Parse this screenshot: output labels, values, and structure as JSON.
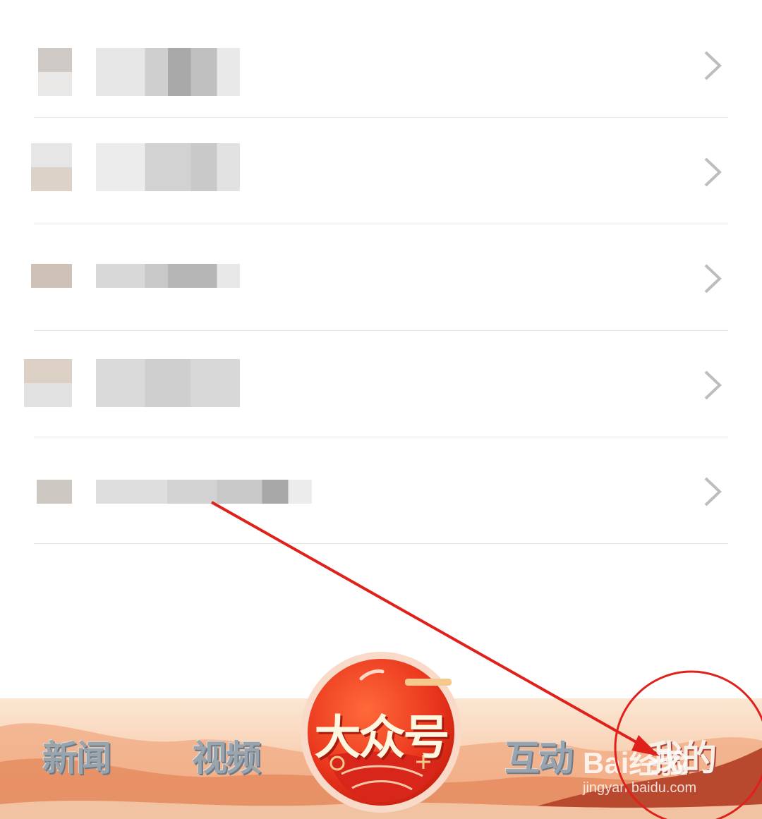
{
  "list": {
    "rows": [
      {
        "label": "",
        "state": "pixelated"
      },
      {
        "label": "",
        "state": "pixelated"
      },
      {
        "label": "",
        "state": "pixelated"
      },
      {
        "label": "",
        "state": "pixelated"
      },
      {
        "label": "",
        "state": "pixelated"
      }
    ],
    "chevron_icon": "chevron-right-icon",
    "divider_color": "#e8e8e8"
  },
  "bottom_nav": {
    "tabs": [
      {
        "label": "新闻"
      },
      {
        "label": "视频"
      },
      {
        "label": "大众号"
      },
      {
        "label": "互动"
      },
      {
        "label": "我的"
      }
    ],
    "accent_color": "#e8341c"
  },
  "watermark": {
    "brand": "Bai经验",
    "url": "jingyan.baidu.com"
  },
  "annotation": {
    "color": "#e0201a",
    "target_tab": "我的"
  }
}
